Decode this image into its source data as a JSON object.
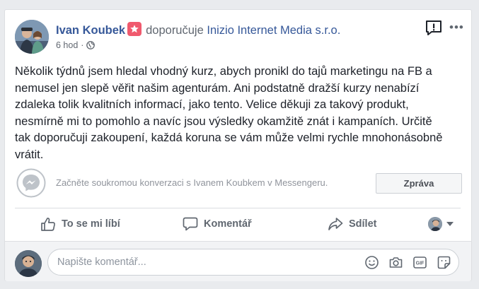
{
  "post": {
    "author": "Ivan Koubek",
    "recommends_text": "doporučuje",
    "page_name": "Inizio Internet Media s.r.o.",
    "time": "6 hod",
    "separator": "·",
    "body": "Několik týdnů jsem hledal vhodný kurz, abych pronikl do tajů marketingu na FB a nemusel jen slepě věřit našim agenturám. Ani podstatně dražší kurzy nenabízí zdaleka tolik kvalitních informací, jako tento. Velice děkuji za takový produkt, nesmírně mi to pomohlo a navíc jsou výsledky okamžitě znát i kampaních. Určitě tak doporučuji zakoupení, každá koruna se vám může velmi rychle mnohonásobně vrátit.",
    "more_label": "•••"
  },
  "messenger": {
    "prompt": "Začněte soukromou konverzaci s Ivanem Koubkem v Messengeru.",
    "button_label": "Zpráva"
  },
  "actions": {
    "like_label": "To se mi líbí",
    "comment_label": "Komentář",
    "share_label": "Sdílet"
  },
  "comment": {
    "placeholder": "Napište komentář..."
  },
  "colors": {
    "link": "#365899",
    "badge": "#f05a6e",
    "muted": "#606770"
  }
}
